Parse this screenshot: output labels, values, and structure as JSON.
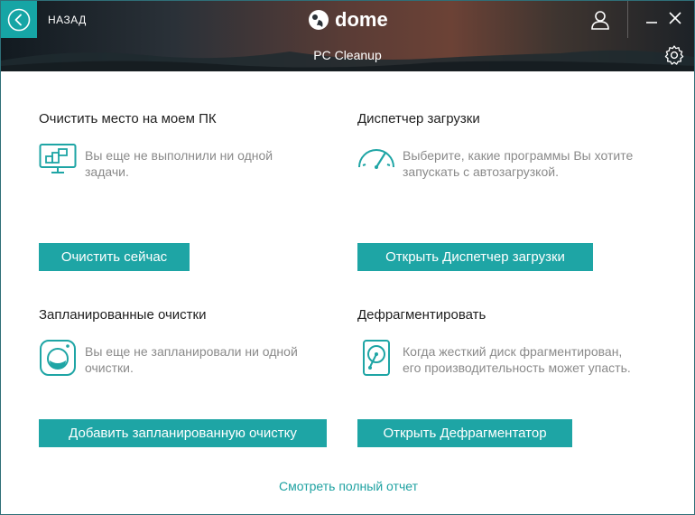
{
  "header": {
    "back_label": "НАЗАД",
    "logo_text": "dome",
    "title": "PC Cleanup"
  },
  "sections": {
    "cleanup": {
      "title": "Очистить место на моем ПК",
      "desc_line1": "Вы еще не выполнили ни одной",
      "desc_line2": "задачи.",
      "button": "Очистить сейчас"
    },
    "startup": {
      "title": "Диспетчер загрузки",
      "desc_line1": "Выберите, какие программы Вы хотите",
      "desc_line2": "запускать с автозагрузкой.",
      "button": "Открыть Диспетчер загрузки"
    },
    "scheduled": {
      "title": "Запланированные очистки",
      "desc_line1": "Вы еще не запланировали ни одной",
      "desc_line2": "очистки.",
      "button": "Добавить запланированную очистку"
    },
    "defrag": {
      "title": "Дефрагментировать",
      "desc_line1": "Когда жесткий диск фрагментирован,",
      "desc_line2": "его производительность может упасть.",
      "button": "Открыть Дефрагментатор"
    }
  },
  "footer": {
    "report_link": "Смотреть полный отчет"
  },
  "colors": {
    "accent": "#1ea5a5",
    "text_dark": "#1f1f1f",
    "text_muted": "#8a8a8a"
  },
  "icons": {
    "back": "chevron-left-circle-icon",
    "user": "user-icon",
    "minimize": "minimize-icon",
    "close": "close-icon",
    "settings": "gear-icon",
    "cleanup": "monitor-chart-icon",
    "startup": "speedometer-icon",
    "scheduled": "washing-machine-icon",
    "defrag": "hard-disk-icon"
  }
}
